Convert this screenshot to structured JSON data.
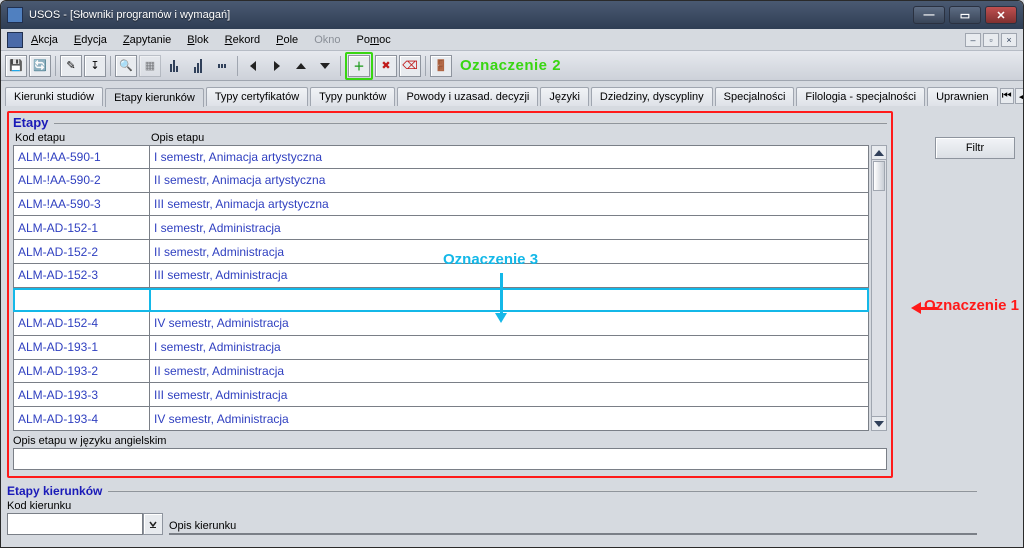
{
  "window": {
    "title": "USOS - [Słowniki programów i wymagań]"
  },
  "menu": {
    "items": [
      "Akcja",
      "Edycja",
      "Zapytanie",
      "Blok",
      "Rekord",
      "Pole",
      "Okno",
      "Pomoc"
    ]
  },
  "annotations": {
    "green_label": "Oznaczenie 2",
    "red_label": "Oznaczenie 1",
    "cyan_label": "Oznaczenie 3"
  },
  "tabs": {
    "items": [
      "Kierunki studiów",
      "Etapy kierunków",
      "Typy certyfikatów",
      "Typy punktów",
      "Powody i uzasad. decyzji",
      "Języki",
      "Dziedziny, dyscypliny",
      "Specjalności",
      "Filologia - specjalności",
      "Uprawnien"
    ],
    "active_index": 1
  },
  "buttons": {
    "filter": "Filtr"
  },
  "etapy": {
    "title": "Etapy",
    "col1": "Kod etapu",
    "col2": "Opis etapu",
    "eng_label": "Opis etapu w języku angielskim",
    "rows": [
      {
        "kod": "ALM-!AA-590-1",
        "opis": "I semestr, Animacja artystyczna"
      },
      {
        "kod": "ALM-!AA-590-2",
        "opis": "II semestr, Animacja artystyczna"
      },
      {
        "kod": "ALM-!AA-590-3",
        "opis": "III semestr, Animacja artystyczna"
      },
      {
        "kod": "ALM-AD-152-1",
        "opis": "I semestr, Administracja"
      },
      {
        "kod": "ALM-AD-152-2",
        "opis": "II semestr, Administracja"
      },
      {
        "kod": "ALM-AD-152-3",
        "opis": "III semestr, Administracja"
      },
      {
        "kod": "",
        "opis": ""
      },
      {
        "kod": "ALM-AD-152-4",
        "opis": "IV semestr, Administracja"
      },
      {
        "kod": "ALM-AD-193-1",
        "opis": "I semestr, Administracja"
      },
      {
        "kod": "ALM-AD-193-2",
        "opis": "II semestr, Administracja"
      },
      {
        "kod": "ALM-AD-193-3",
        "opis": "III semestr, Administracja"
      },
      {
        "kod": "ALM-AD-193-4",
        "opis": "IV semestr, Administracja"
      }
    ],
    "highlight_row_index": 6
  },
  "kierunki": {
    "title": "Etapy kierunków",
    "kod_label": "Kod kierunku",
    "opis_label": "Opis kierunku"
  }
}
